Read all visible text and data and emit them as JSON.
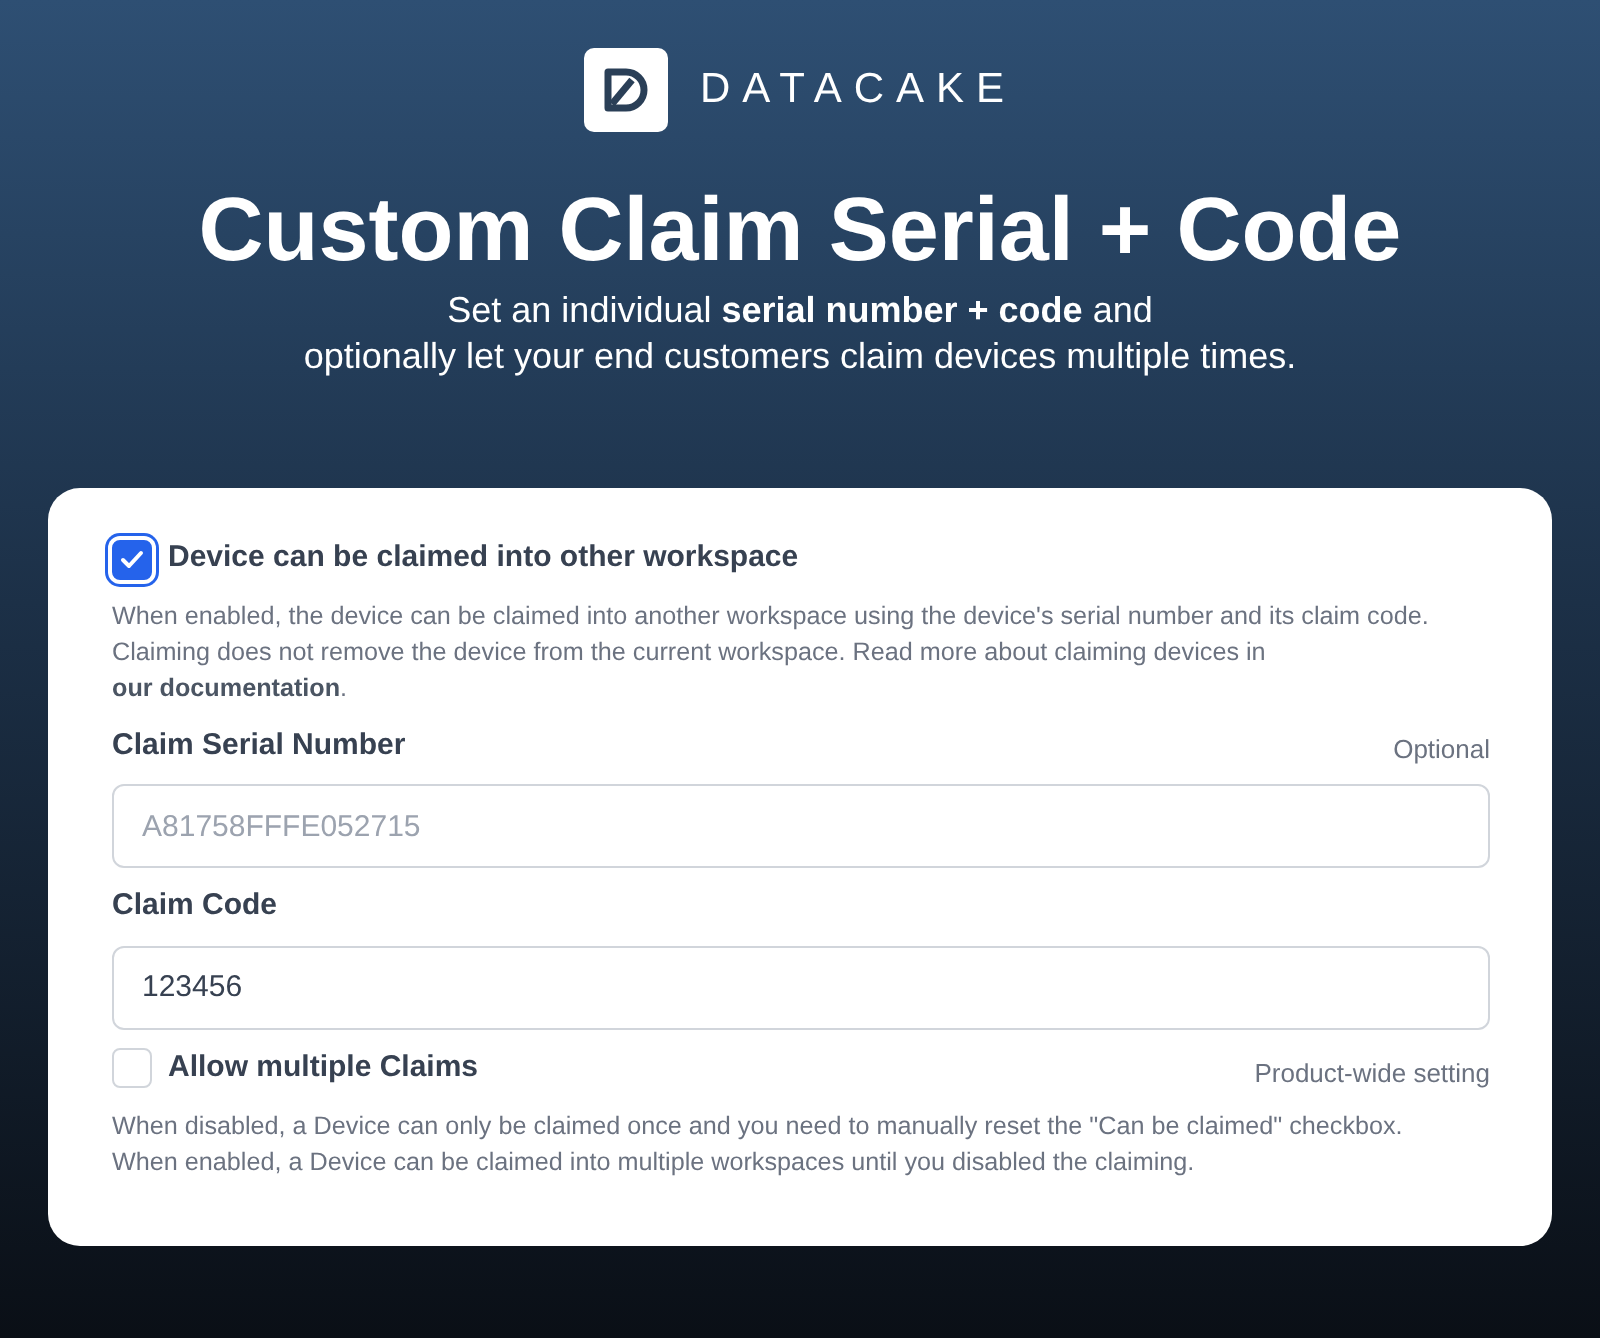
{
  "brand": {
    "name": "DATACAKE"
  },
  "hero": {
    "title": "Custom Claim Serial + Code",
    "subtitle_lines": [
      "Set an individual **serial number + code** and",
      "optionally let your end customers claim devices multiple times."
    ]
  },
  "form": {
    "claimable": {
      "label": "Device can be claimed into other workspace",
      "checked": true,
      "help": "When enabled, the device can be claimed into another workspace using the device's serial number and its claim code. Claiming does not remove the device from the current workspace. Read more about claiming devices in ",
      "link": "our documentation",
      "help_end": "."
    },
    "fields": [
      {
        "label": "Claim Serial Number",
        "hint": "Optional",
        "placeholder": "A81758FFFE052715"
      },
      {
        "label": "Claim Code",
        "value": "123456"
      }
    ],
    "multiple": {
      "label": "Allow multiple Claims",
      "checked": false,
      "hint": "Product-wide setting",
      "help_lines": [
        "When disabled, a Device can only be claimed once and you need to manually reset the \"Can be claimed\" checkbox.",
        "When enabled, a Device can be claimed into multiple workspaces until you disabled the claiming."
      ]
    }
  }
}
